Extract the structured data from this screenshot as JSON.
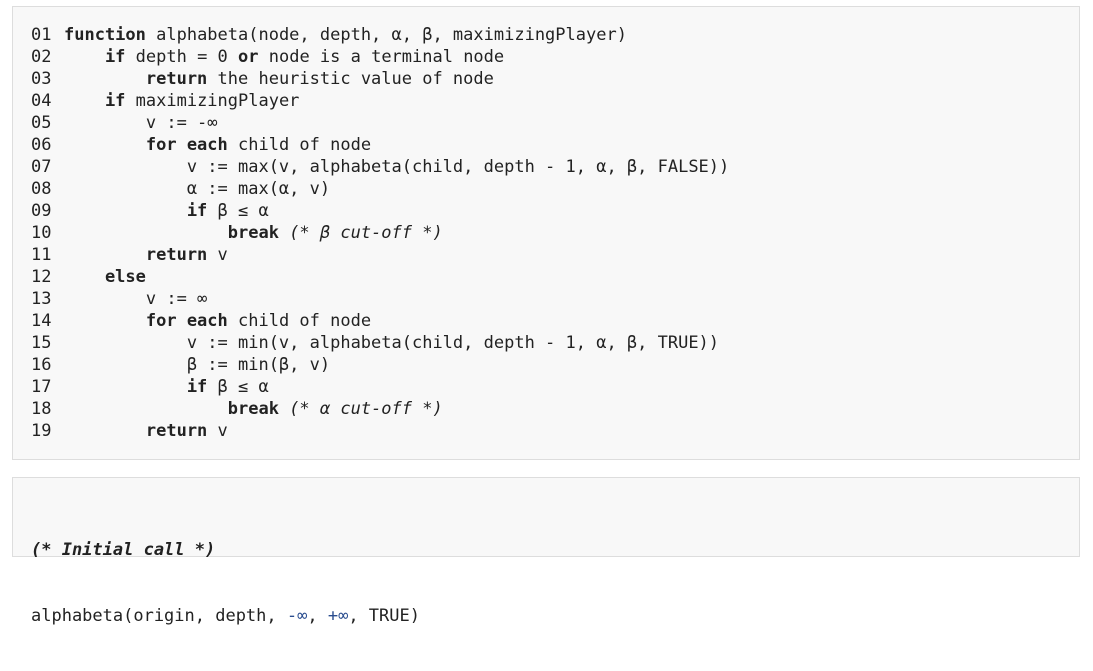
{
  "listing": {
    "lines": [
      {
        "num": "01",
        "indent": 0,
        "segments": [
          {
            "t": "function",
            "s": "kw"
          },
          {
            "t": " alphabeta(node, depth, α, β, maximizingPlayer)",
            "s": ""
          }
        ]
      },
      {
        "num": "02",
        "indent": 1,
        "segments": [
          {
            "t": "if",
            "s": "kw"
          },
          {
            "t": " depth = 0 ",
            "s": ""
          },
          {
            "t": "or",
            "s": "kw"
          },
          {
            "t": " node is a terminal node",
            "s": ""
          }
        ]
      },
      {
        "num": "03",
        "indent": 2,
        "segments": [
          {
            "t": "return",
            "s": "kw"
          },
          {
            "t": " the heuristic value of node",
            "s": ""
          }
        ]
      },
      {
        "num": "04",
        "indent": 1,
        "segments": [
          {
            "t": "if",
            "s": "kw"
          },
          {
            "t": " maximizingPlayer",
            "s": ""
          }
        ]
      },
      {
        "num": "05",
        "indent": 2,
        "segments": [
          {
            "t": "v := -∞",
            "s": ""
          }
        ]
      },
      {
        "num": "06",
        "indent": 2,
        "segments": [
          {
            "t": "for each",
            "s": "kw"
          },
          {
            "t": " child of node",
            "s": ""
          }
        ]
      },
      {
        "num": "07",
        "indent": 3,
        "segments": [
          {
            "t": "v := max(v, alphabeta(child, depth - 1, α, β, FALSE))",
            "s": ""
          }
        ]
      },
      {
        "num": "08",
        "indent": 3,
        "segments": [
          {
            "t": "α := max(α, v)",
            "s": ""
          }
        ]
      },
      {
        "num": "09",
        "indent": 3,
        "segments": [
          {
            "t": "if",
            "s": "kw"
          },
          {
            "t": " β ≤ α",
            "s": ""
          }
        ]
      },
      {
        "num": "10",
        "indent": 4,
        "segments": [
          {
            "t": "break",
            "s": "kw"
          },
          {
            "t": " ",
            "s": ""
          },
          {
            "t": "(* β cut-off *)",
            "s": "cm"
          }
        ]
      },
      {
        "num": "11",
        "indent": 2,
        "segments": [
          {
            "t": "return",
            "s": "kw"
          },
          {
            "t": " v",
            "s": ""
          }
        ]
      },
      {
        "num": "12",
        "indent": 1,
        "segments": [
          {
            "t": "else",
            "s": "kw"
          }
        ]
      },
      {
        "num": "13",
        "indent": 2,
        "segments": [
          {
            "t": "v := ∞",
            "s": ""
          }
        ]
      },
      {
        "num": "14",
        "indent": 2,
        "segments": [
          {
            "t": "for each",
            "s": "kw"
          },
          {
            "t": " child of node",
            "s": ""
          }
        ]
      },
      {
        "num": "15",
        "indent": 3,
        "segments": [
          {
            "t": "v := min(v, alphabeta(child, depth - 1, α, β, TRUE))",
            "s": ""
          }
        ]
      },
      {
        "num": "16",
        "indent": 3,
        "segments": [
          {
            "t": "β := min(β, v)",
            "s": ""
          }
        ]
      },
      {
        "num": "17",
        "indent": 3,
        "segments": [
          {
            "t": "if",
            "s": "kw"
          },
          {
            "t": " β ≤ α",
            "s": ""
          }
        ]
      },
      {
        "num": "18",
        "indent": 4,
        "segments": [
          {
            "t": "break",
            "s": "kw"
          },
          {
            "t": " ",
            "s": ""
          },
          {
            "t": "(* α cut-off *)",
            "s": "cm"
          }
        ]
      },
      {
        "num": "19",
        "indent": 2,
        "segments": [
          {
            "t": "return",
            "s": "kw"
          },
          {
            "t": " v",
            "s": ""
          }
        ]
      }
    ]
  },
  "initial_call": {
    "comment": "(* Initial call *)",
    "call_prefix": "alphabeta(origin, depth, ",
    "neg_inf": "-∞",
    "sep": ", ",
    "pos_inf": "+∞",
    "call_suffix": ", TRUE)"
  },
  "colors": {
    "block_background": "#f8f8f8",
    "block_border": "#dddddd",
    "text": "#222222",
    "infinity_literal": "#2a4d8f"
  }
}
